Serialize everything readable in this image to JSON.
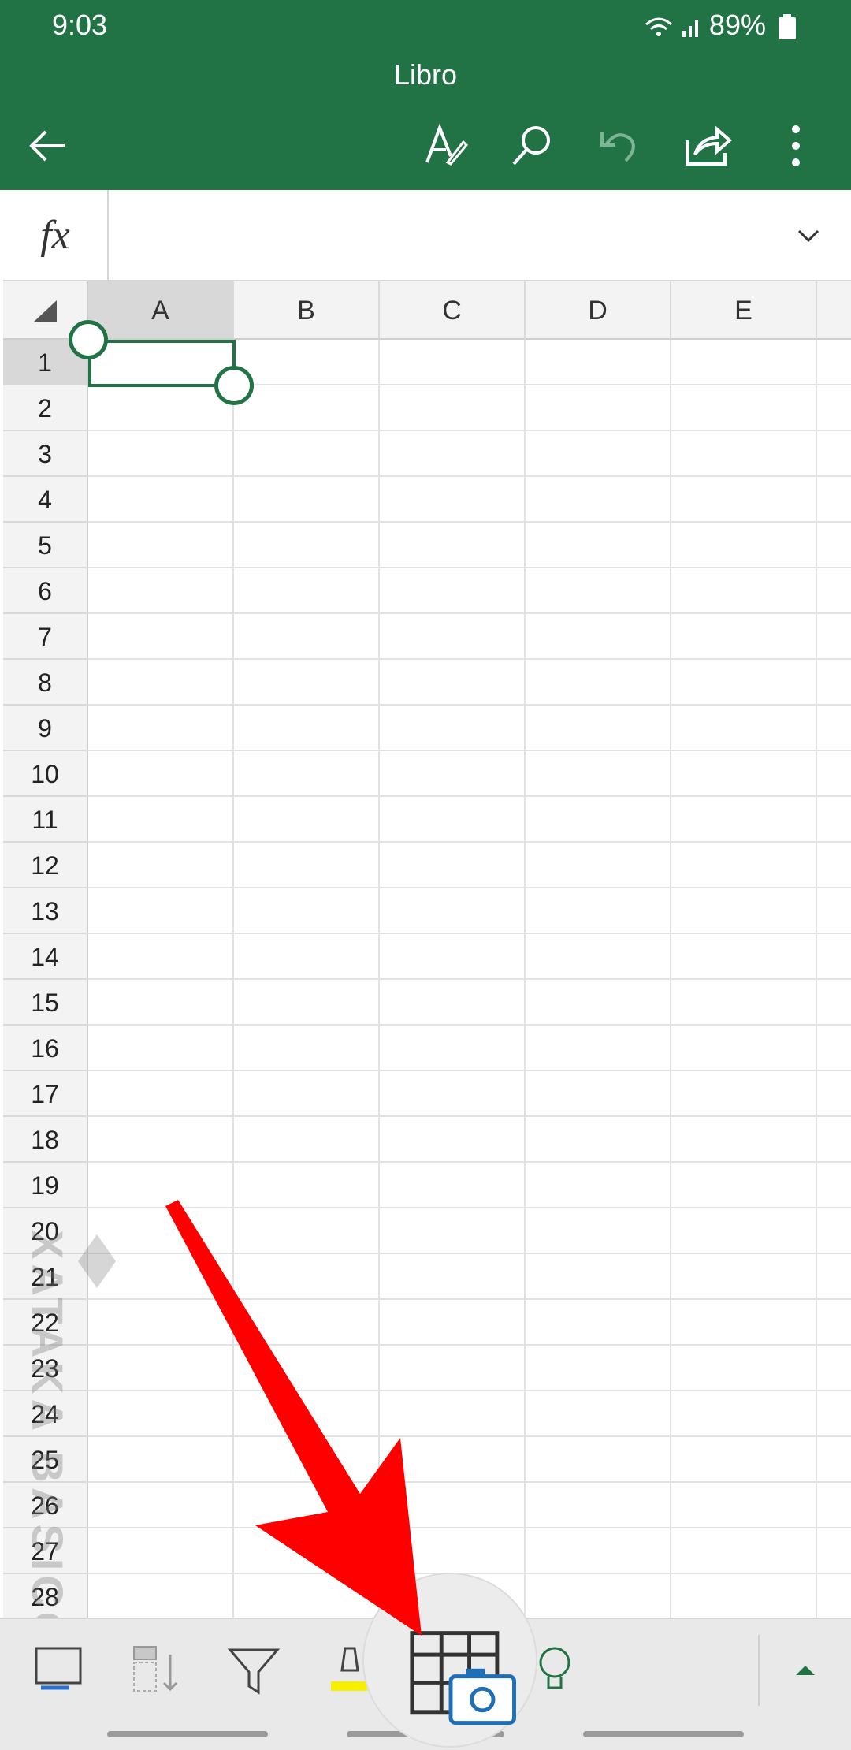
{
  "status_bar": {
    "time": "9:03",
    "battery": "89%"
  },
  "header": {
    "title": "Libro",
    "icons": [
      "back-arrow-icon",
      "draw-pen-icon",
      "search-icon",
      "undo-icon",
      "share-icon",
      "more-vert-icon"
    ]
  },
  "formula_bar": {
    "fx_label": "fx",
    "value": ""
  },
  "grid": {
    "columns": [
      "A",
      "B",
      "C",
      "D",
      "E"
    ],
    "rows": [
      "1",
      "2",
      "3",
      "4",
      "5",
      "6",
      "7",
      "8",
      "9",
      "10",
      "11",
      "12",
      "13",
      "14",
      "15",
      "16",
      "17",
      "18",
      "19",
      "20",
      "21",
      "22",
      "23",
      "24",
      "25",
      "26",
      "27",
      "28"
    ],
    "selected_cell": "A1"
  },
  "toolbar": {
    "icons": [
      "cell-style-icon",
      "sort-icon",
      "filter-icon",
      "highlight-icon",
      "table-camera-icon",
      "lightbulb-icon",
      "expand-up-icon"
    ]
  },
  "watermark": "XATAKA BASICOS",
  "colors": {
    "accent": "#217346",
    "arrow": "#ff0000"
  }
}
